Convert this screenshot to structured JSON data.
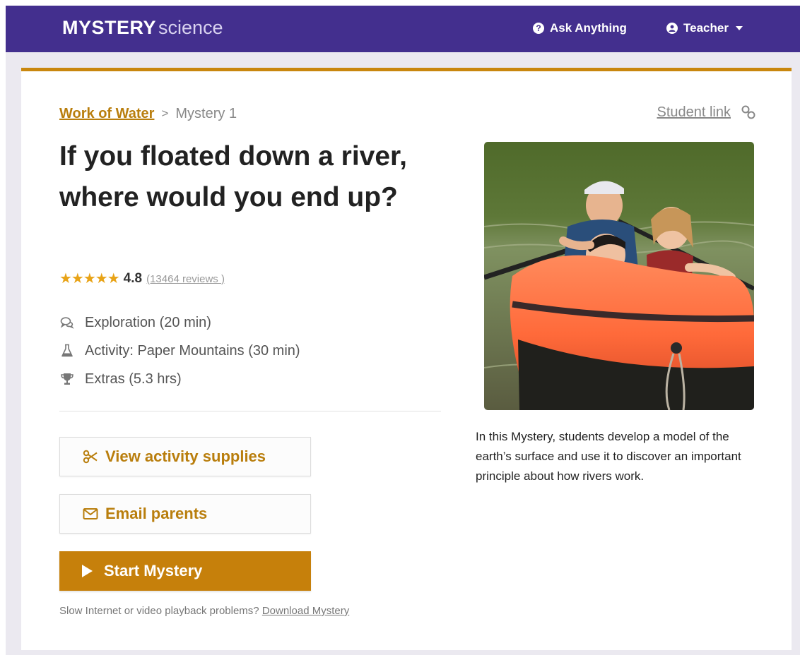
{
  "header": {
    "logo_bold": "MYSTERY",
    "logo_light": "science",
    "ask_label": "Ask Anything",
    "teacher_label": "Teacher"
  },
  "breadcrumb": {
    "unit": "Work of Water",
    "separator": ">",
    "current": "Mystery 1"
  },
  "student_link": "Student link",
  "mystery": {
    "title": "If you floated down a river, where would you end up?",
    "stars": "★★★★★",
    "rating": "4.8",
    "reviews": "(13464 reviews )",
    "details": [
      {
        "icon": "chat-icon",
        "label": "Exploration (20 min)"
      },
      {
        "icon": "flask-icon",
        "label": "Activity: Paper Mountains (30 min)"
      },
      {
        "icon": "trophy-icon",
        "label": "Extras (5.3 hrs)"
      }
    ],
    "description": "In this Mystery, students develop a model of the earth’s surface and use it to discover an important principle about how rivers work."
  },
  "buttons": {
    "supplies": "View activity supplies",
    "email": "Email parents",
    "start": "Start Mystery"
  },
  "help": {
    "text": "Slow Internet or video playback problems?",
    "link": "Download Mystery"
  },
  "colors": {
    "nav": "#432f8e",
    "accent": "#c6800b",
    "link": "#b97e0d",
    "star": "#e8a317"
  }
}
